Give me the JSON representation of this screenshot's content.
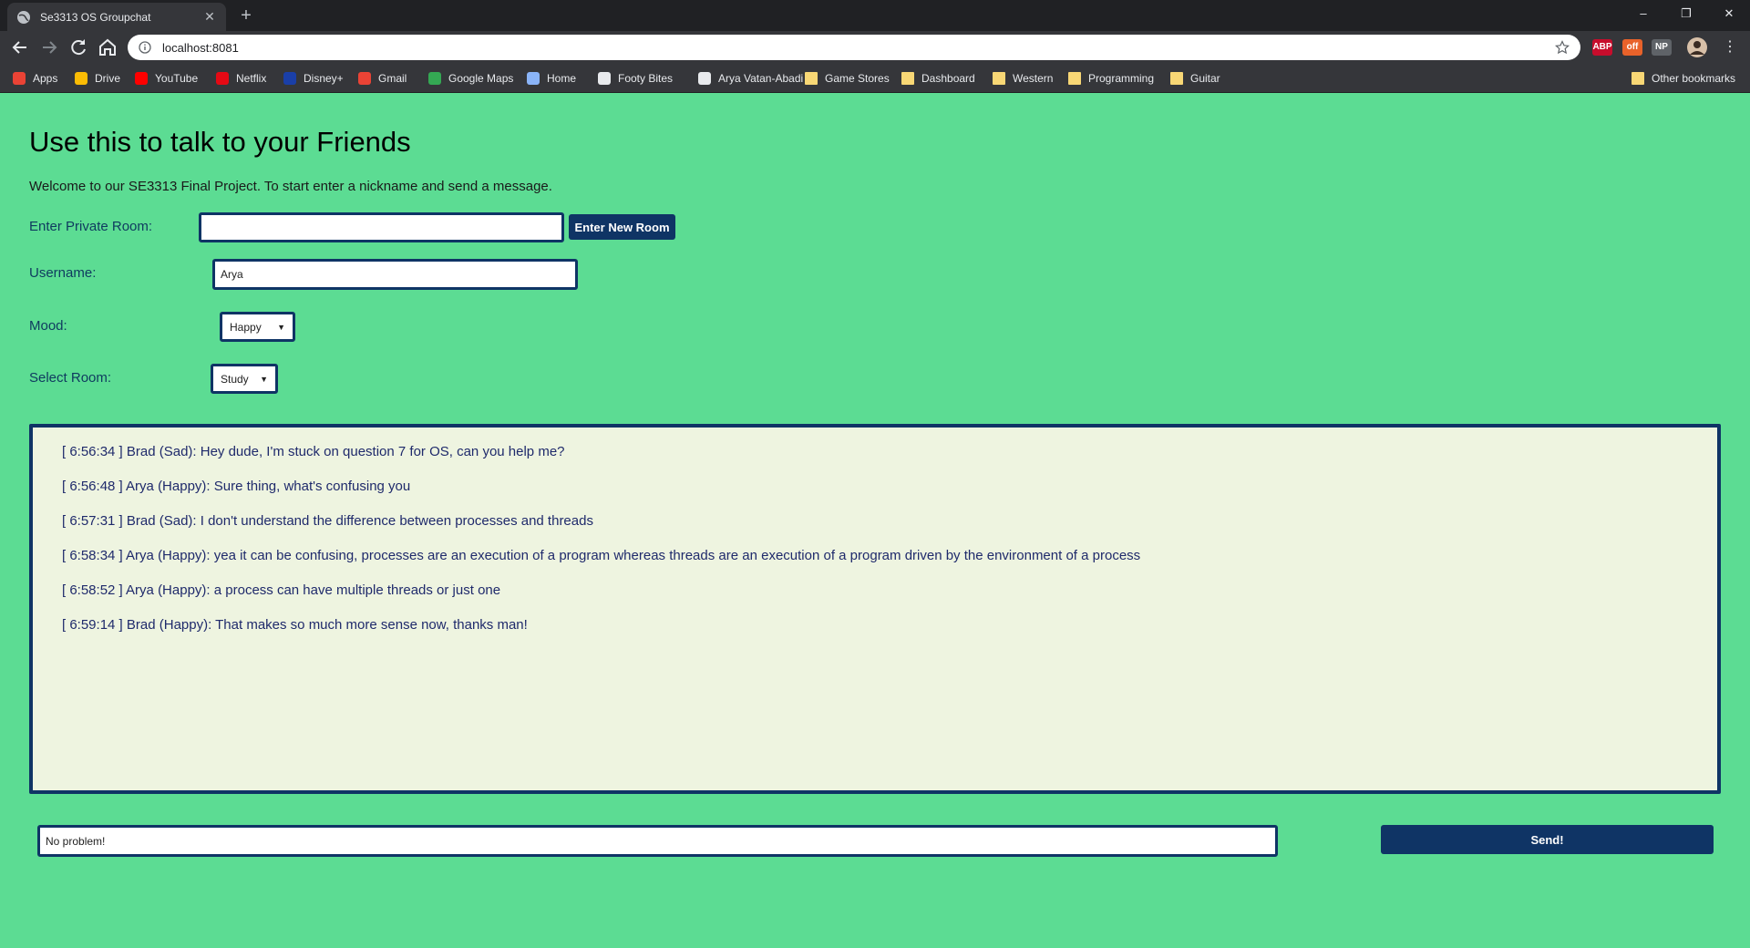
{
  "browser": {
    "tab_title": "Se3313 OS Groupchat",
    "new_tab_label": "+",
    "url": "localhost:8081",
    "window_controls": {
      "minimize": "–",
      "restore": "❐",
      "close": "✕"
    },
    "extensions": [
      {
        "name": "abp-icon",
        "label": "ABP",
        "color": "#c70d2c"
      },
      {
        "name": "off-icon",
        "label": "off",
        "color": "#e8622a"
      },
      {
        "name": "np-icon",
        "label": "NP",
        "color": "#5f6368"
      }
    ]
  },
  "bookmarks": [
    {
      "label": "Apps",
      "icon": "apps-grid-icon"
    },
    {
      "label": "Drive",
      "icon": "drive-icon"
    },
    {
      "label": "YouTube",
      "icon": "youtube-icon"
    },
    {
      "label": "Netflix",
      "icon": "netflix-icon"
    },
    {
      "label": "Disney+",
      "icon": "disney-icon"
    },
    {
      "label": "Gmail",
      "icon": "gmail-icon"
    },
    {
      "label": "Google Maps",
      "icon": "maps-icon"
    },
    {
      "label": "Home",
      "icon": "shield-icon"
    },
    {
      "label": "Footy Bites",
      "icon": "football-icon"
    },
    {
      "label": "Arya Vatan-Abadi",
      "icon": "a-logo-icon"
    },
    {
      "label": "Game Stores",
      "icon": "folder-icon"
    },
    {
      "label": "Dashboard",
      "icon": "folder-icon"
    },
    {
      "label": "Western",
      "icon": "folder-icon"
    },
    {
      "label": "Programming",
      "icon": "folder-icon"
    },
    {
      "label": "Guitar",
      "icon": "folder-icon"
    },
    {
      "label": "Other bookmarks",
      "icon": "folder-icon"
    }
  ],
  "page": {
    "title": "Use this to talk to your Friends",
    "welcome": "Welcome to our SE3313 Final Project. To start enter a nickname and send a message.",
    "private_room_label": "Enter Private Room:",
    "private_room_value": "",
    "enter_room_button": "Enter New Room",
    "username_label": "Username:",
    "username_value": "Arya",
    "mood_label": "Mood:",
    "mood_value": "Happy",
    "room_label": "Select Room:",
    "room_value": "Study",
    "messages": [
      "[ 6:56:34 ] Brad (Sad): Hey dude, I'm stuck on question 7 for OS, can you help me?",
      "[ 6:56:48 ] Arya (Happy): Sure thing, what's confusing you",
      "[ 6:57:31 ] Brad (Sad): I don't understand the difference between processes and threads",
      "[ 6:58:34 ] Arya (Happy): yea it can be confusing, processes are an execution of a program whereas threads are an execution of a program driven by the environment of a process",
      "[ 6:58:52 ] Arya (Happy): a process can have multiple threads or just one",
      "[ 6:59:14 ] Brad (Happy): That makes so much more sense now, thanks man!"
    ],
    "message_value": "No problem!",
    "send_button": "Send!"
  },
  "colors": {
    "page_background": "#5cdc93",
    "accent_navy": "#0f3465",
    "chat_background": "#eef4e0",
    "chat_text": "#1f2a6b"
  }
}
